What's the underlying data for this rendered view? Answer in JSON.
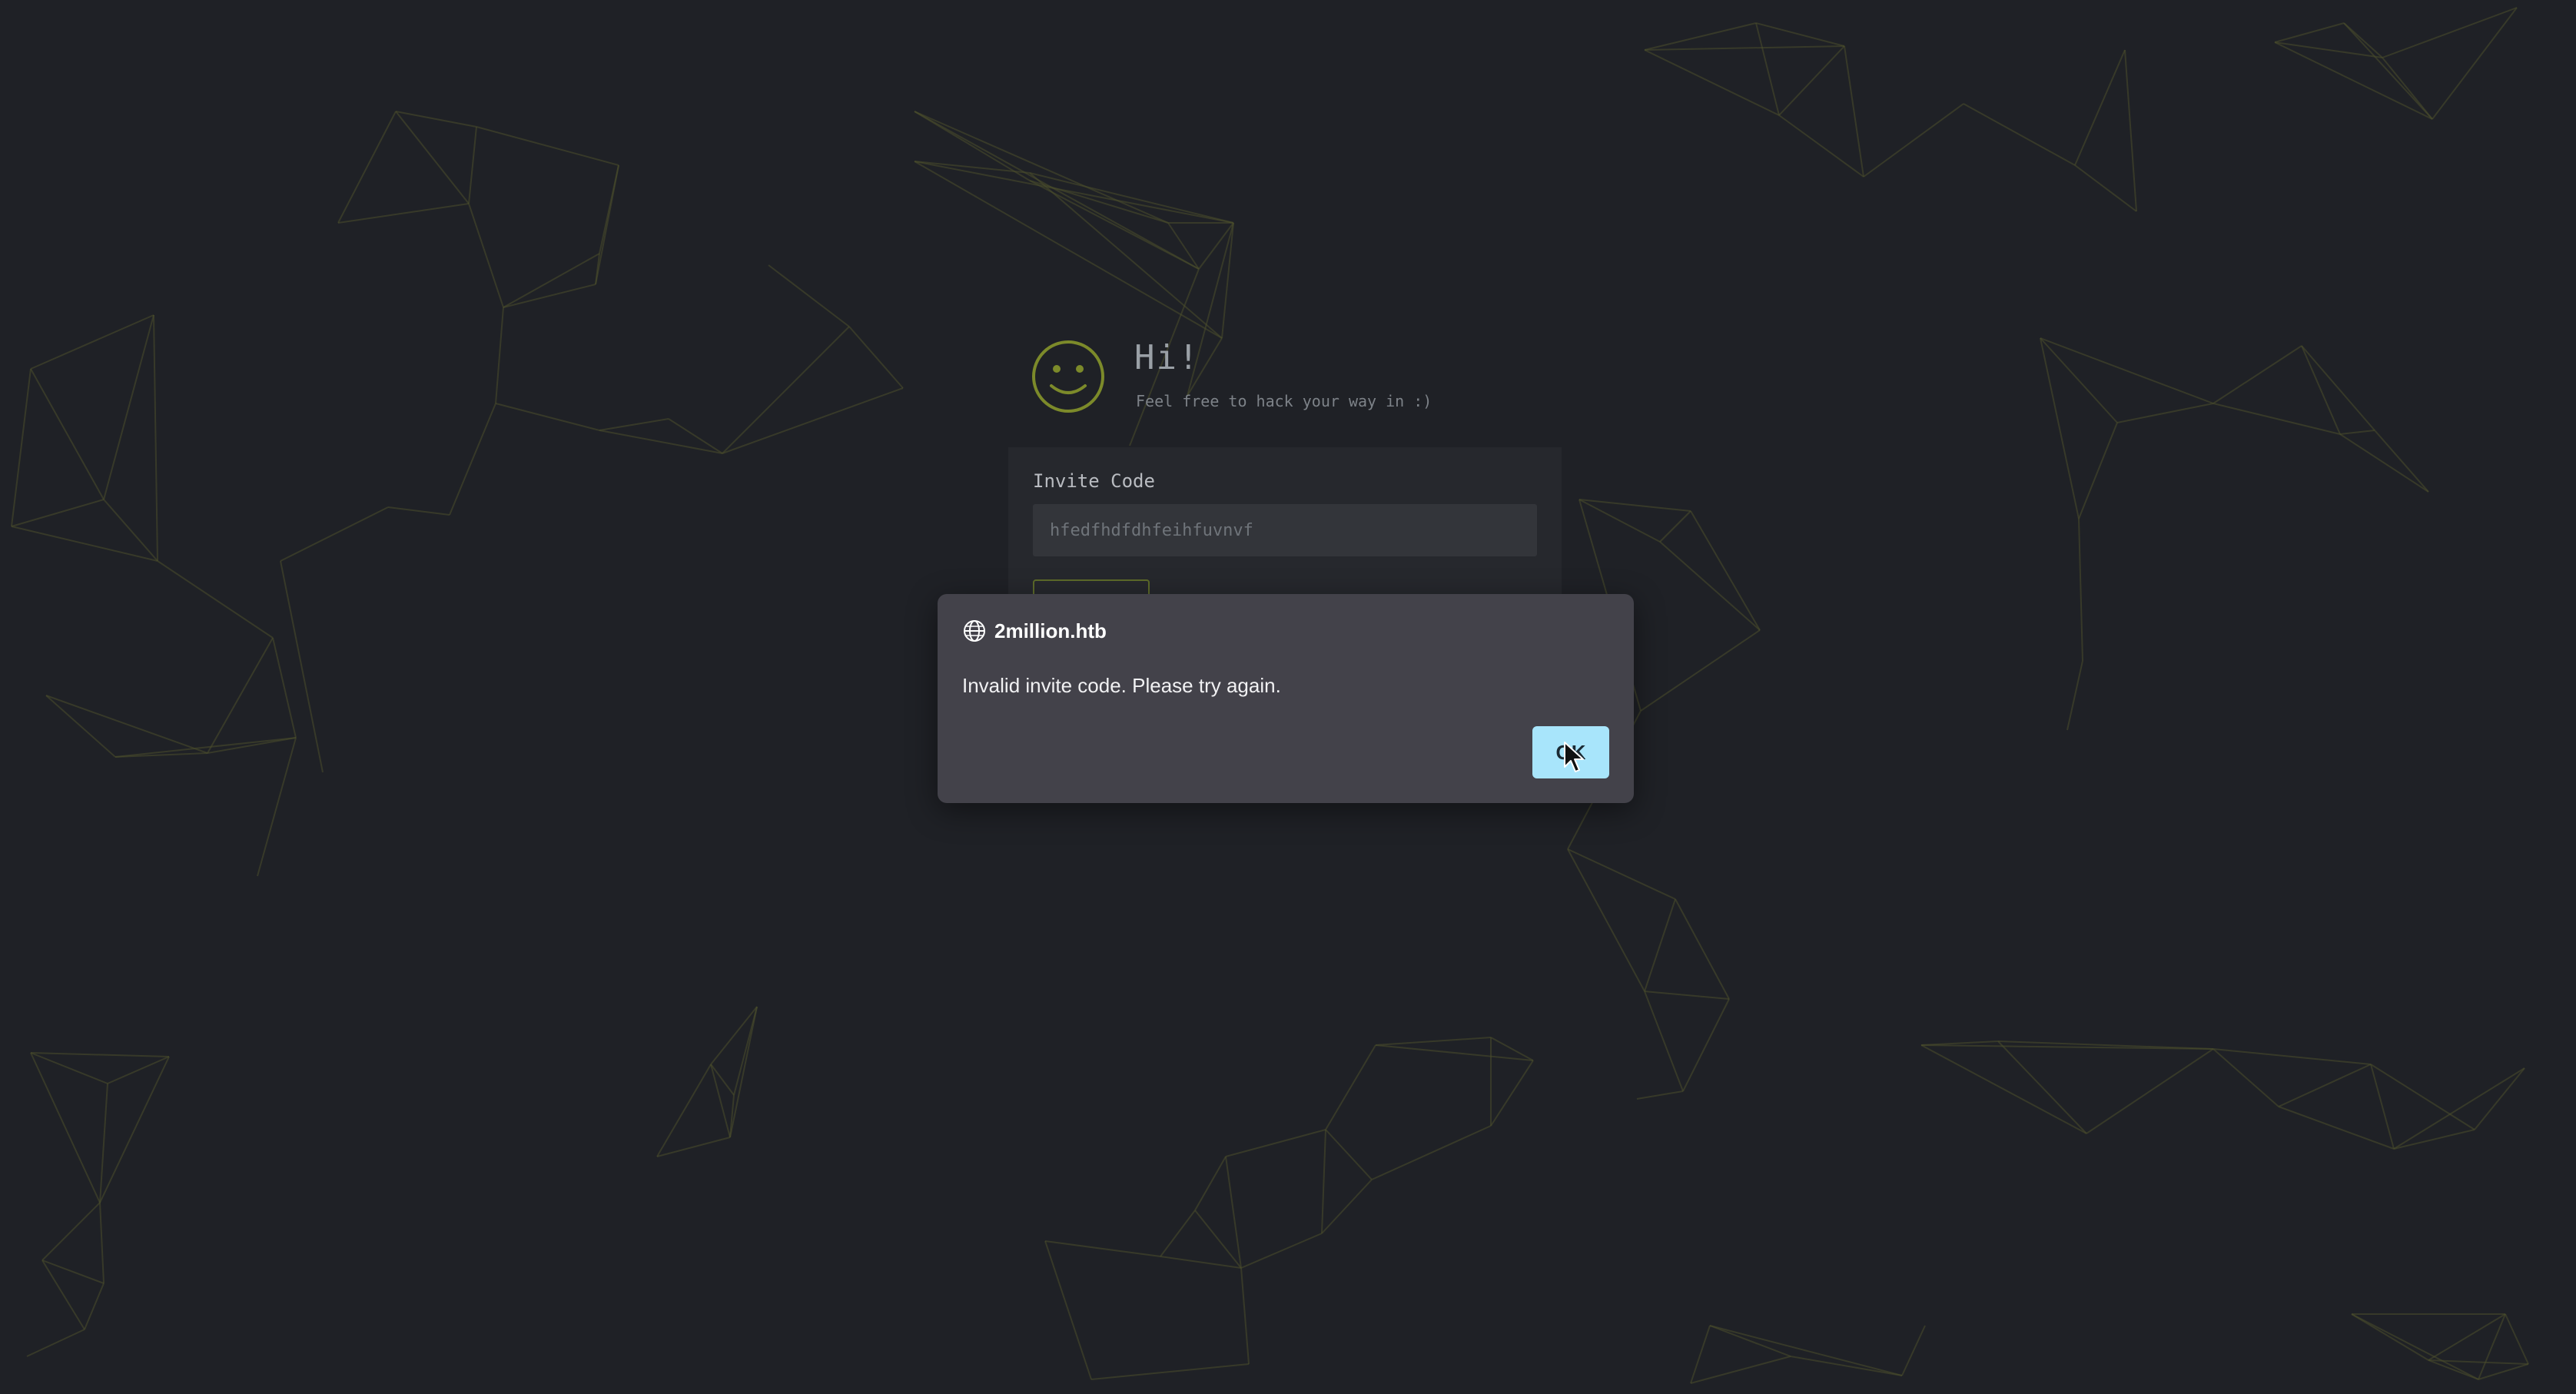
{
  "greeting": {
    "title": "Hi!",
    "subtitle": "Feel free to hack your way in :)",
    "icon": "smiley-icon"
  },
  "form": {
    "invite_label": "Invite Code",
    "invite_value": "hfedfhdfdhfeihfuvnvf"
  },
  "dialog": {
    "origin": "2million.htb",
    "message": "Invalid invite code. Please try again.",
    "ok_label": "OK",
    "origin_icon": "globe-icon"
  },
  "colors": {
    "background": "#1f2126",
    "network_lines": "#4a4e2c",
    "smiley": "#7c8a2a",
    "dialog": "#43424a",
    "ok_button": "#a8e5fb"
  }
}
